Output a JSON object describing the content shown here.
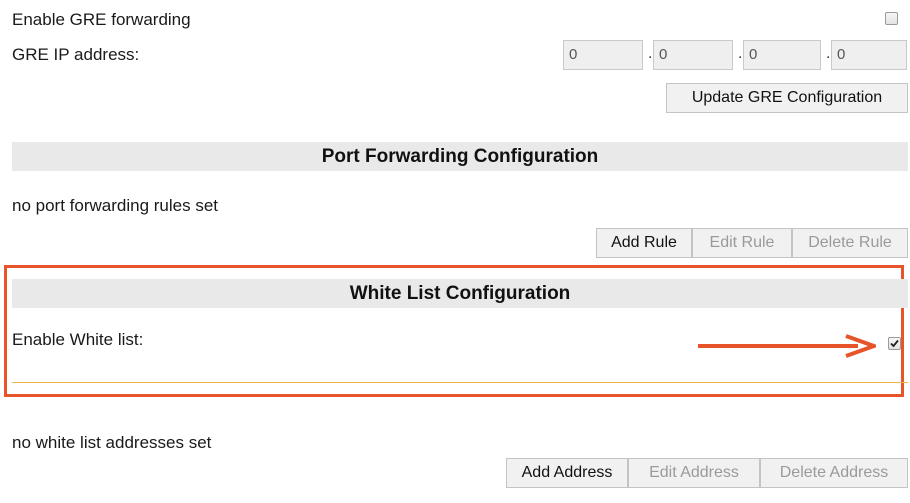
{
  "gre": {
    "enable_label": "Enable GRE forwarding",
    "enabled": false,
    "ip_label": "GRE IP address:",
    "ip_octets": [
      "0",
      "0",
      "0",
      "0"
    ],
    "dot": ".",
    "update_button": "Update GRE Configuration"
  },
  "port_forwarding": {
    "header": "Port Forwarding Configuration",
    "status": "no port forwarding rules set",
    "add_button": "Add Rule",
    "edit_button": "Edit Rule",
    "delete_button": "Delete Rule"
  },
  "white_list": {
    "header": "White List Configuration",
    "enable_label": "Enable White list:",
    "enabled": true,
    "status": "no white list addresses set",
    "add_button": "Add Address",
    "edit_button": "Edit Address",
    "delete_button": "Delete Address"
  },
  "colors": {
    "highlight": "#e8542a",
    "header_bg": "#e9e9e9"
  }
}
